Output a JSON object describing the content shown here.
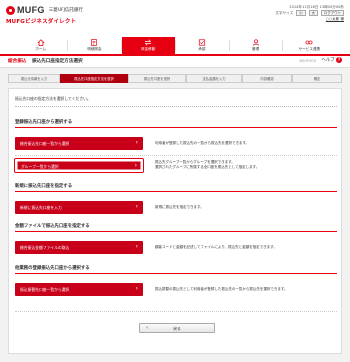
{
  "header": {
    "logo_text": "MUFG",
    "bank_name": "三菱UFJ信託銀行",
    "service_name": "MUFGビジネスダイレクト",
    "datetime": "2014年11月18日 13時00分00秒",
    "text_size_label": "文字サイズ",
    "text_size_small": "小",
    "text_size_large": "大",
    "logout_label": "ログアウト",
    "user_name": "○○太郎 様",
    "nav": [
      {
        "label": "ホーム",
        "icon": "home-icon"
      },
      {
        "label": "明細照会",
        "icon": "document-icon"
      },
      {
        "label": "資金移動",
        "icon": "transfer-icon"
      },
      {
        "label": "承認",
        "icon": "approval-icon"
      },
      {
        "label": "管理",
        "icon": "admin-icon"
      },
      {
        "label": "サービス連携",
        "icon": "service-icon"
      }
    ],
    "active_nav_index": 2
  },
  "titlebar": {
    "category": "総合振込",
    "title": "振込先口座指定方法選択",
    "screen_id": "BSOF003",
    "help_label": "ヘルプ"
  },
  "steps": [
    "振込元情報を入力",
    "振込先口座指定方法を選択",
    "振込先口座を選択",
    "支払金額を入力",
    "内容確認",
    "確定"
  ],
  "active_step_index": 1,
  "main": {
    "intro": "振込先口座の指定方法を選択してください。",
    "sections": [
      {
        "heading": "登録振込先口座から選択する",
        "rows": [
          {
            "button": "総合振込先口座一覧から選択",
            "desc": [
              "利用者が登録した振込先の一覧から振込先を選択できます。"
            ]
          },
          {
            "button": "グループ一覧から選択",
            "desc": [
              "振込先グループ一覧からグループを選択できます。",
              "選択されたグループに所属する全口座を振込先として指定します。"
            ]
          }
        ]
      },
      {
        "heading": "新規に振込先口座を指定する",
        "rows": [
          {
            "button": "新規に振込先口座を入力",
            "desc": [
              "新規に振込先を指定できます。"
            ]
          }
        ]
      },
      {
        "heading": "金額ファイルで振込先口座を指定する",
        "rows": [
          {
            "button": "総合振込金額ファイルの取込",
            "desc": [
              "顧客コードと金額を記述してファイルにより、振込先と金額を指定できます。"
            ]
          }
        ]
      },
      {
        "heading": "他業務の登録振込先口座から選択する",
        "rows": [
          {
            "button": "振込振替先口座一覧から選択",
            "desc": [
              "振込振替の振込先として利用者が登録した振込先の一覧から振込先を選択できます。"
            ]
          }
        ]
      }
    ],
    "selected_button": "グループ一覧から選択"
  },
  "back_button": "戻る"
}
